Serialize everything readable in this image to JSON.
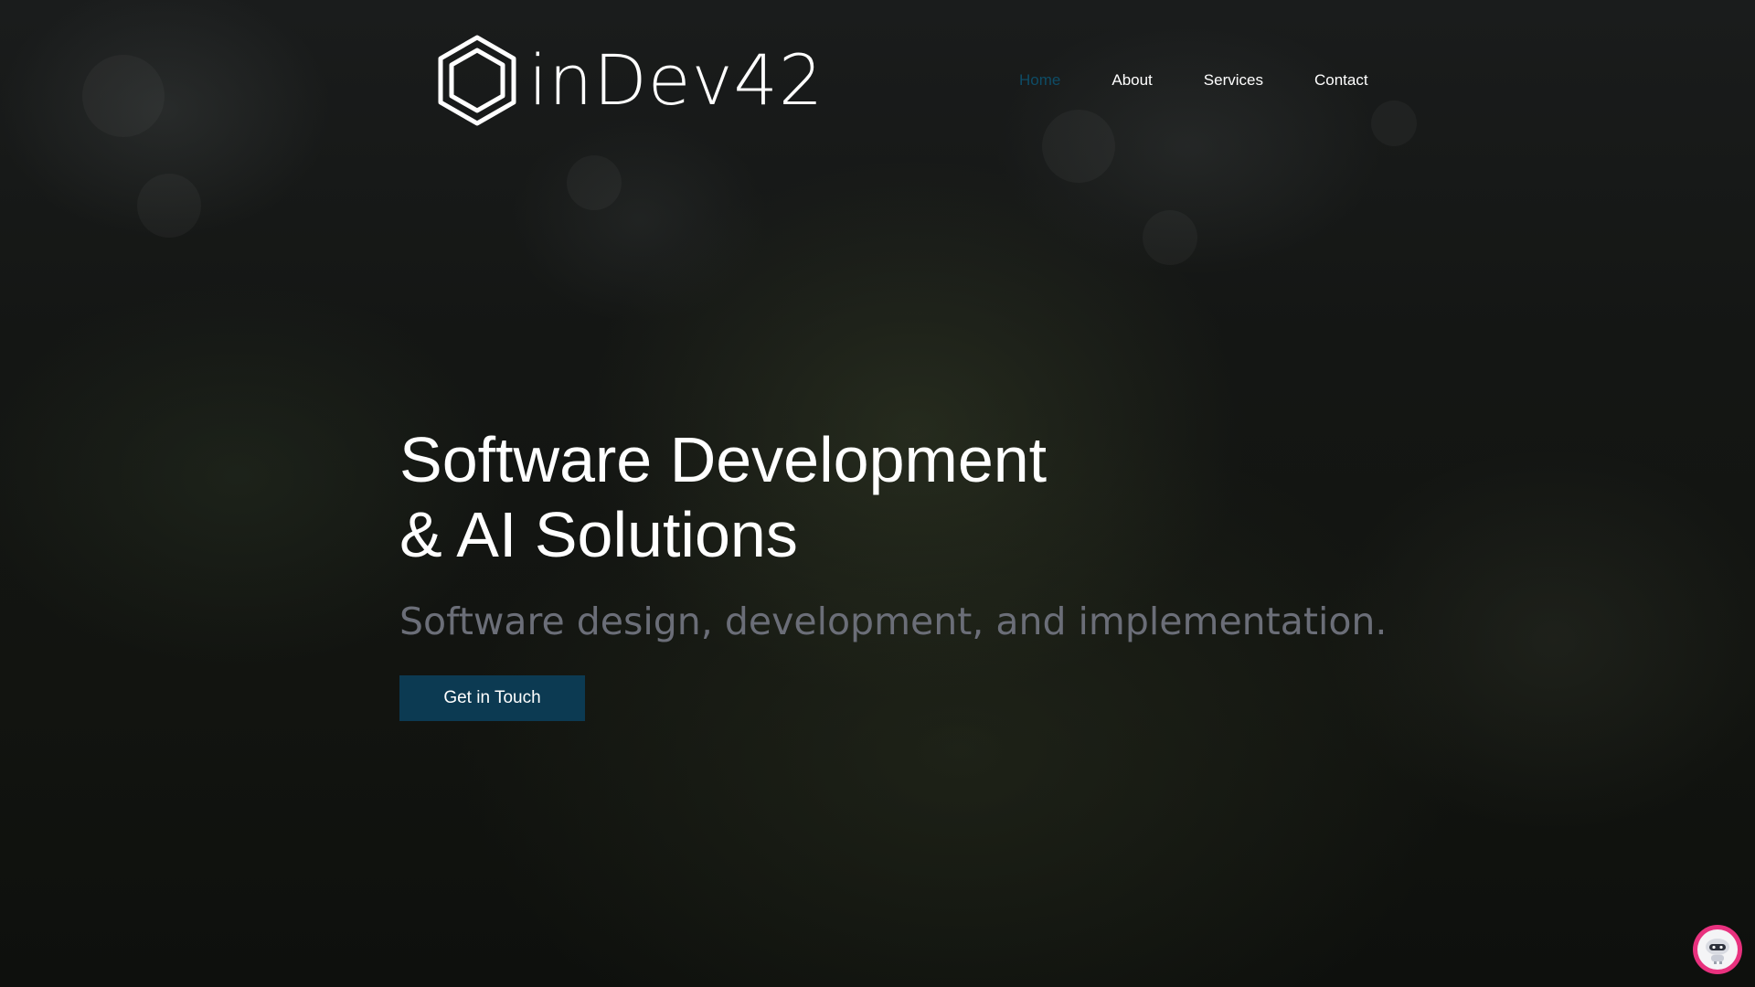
{
  "brand": {
    "name": "inDev42",
    "logo_icon": "hexagon-icon"
  },
  "nav": {
    "items": [
      {
        "label": "Home",
        "active": true
      },
      {
        "label": "About",
        "active": false
      },
      {
        "label": "Services",
        "active": false
      },
      {
        "label": "Contact",
        "active": false
      }
    ]
  },
  "hero": {
    "headline_line1": "Software Development",
    "headline_line2": "& AI Solutions",
    "subtitle": "Software design, development, and implementation.",
    "cta_label": "Get in Touch"
  },
  "chat_widget": {
    "icon": "chat-bot-icon"
  },
  "colors": {
    "active_nav": "#0e4c66",
    "cta_background": "#0c3a52",
    "subtitle": "#6b6e78",
    "chat_widget_ring": "#e8317e"
  }
}
